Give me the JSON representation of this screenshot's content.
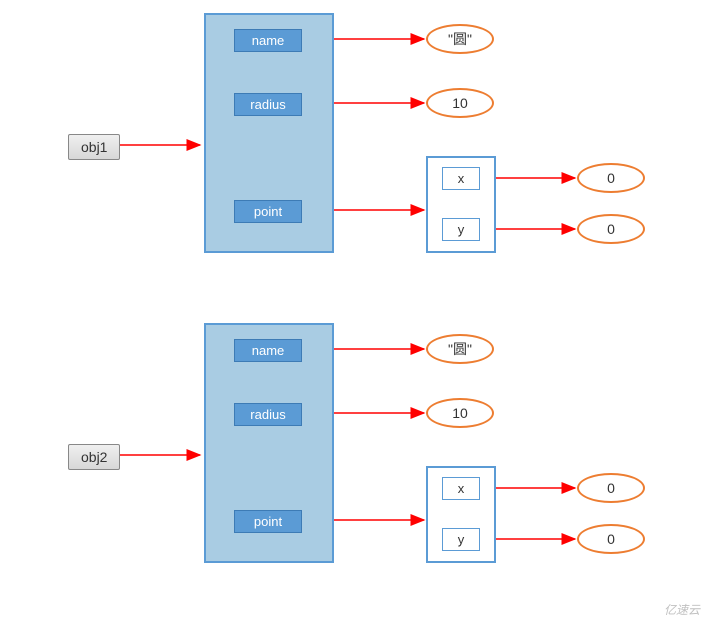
{
  "obj1": {
    "label": "obj1",
    "fields": {
      "name": {
        "label": "name",
        "value": "\"圆\""
      },
      "radius": {
        "label": "radius",
        "value": "10"
      },
      "point": {
        "label": "point",
        "x": {
          "label": "x",
          "value": "0"
        },
        "y": {
          "label": "y",
          "value": "0"
        }
      }
    }
  },
  "obj2": {
    "label": "obj2",
    "fields": {
      "name": {
        "label": "name",
        "value": "\"圆\""
      },
      "radius": {
        "label": "radius",
        "value": "10"
      },
      "point": {
        "label": "point",
        "x": {
          "label": "x",
          "value": "0"
        },
        "y": {
          "label": "y",
          "value": "0"
        }
      }
    }
  },
  "watermark": "亿速云"
}
